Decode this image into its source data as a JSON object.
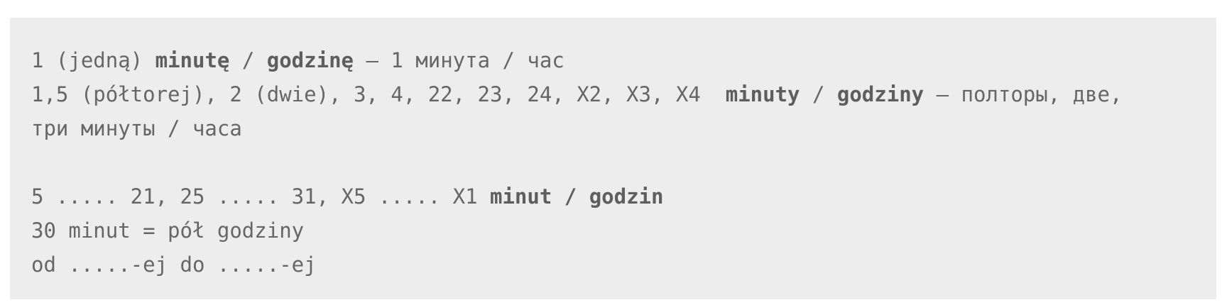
{
  "document": {
    "line1": {
      "a": "1 (jedną) ",
      "b1": "minutę",
      "c": " / ",
      "b2": "godzinę",
      "d": " – 1 минута / час"
    },
    "line2": {
      "a": "1,5 (półtorej), 2 (dwie), 3, 4, 22, 23, 24, X2, X3, X4  ",
      "b1": "minuty",
      "c": " / ",
      "b2": "godziny",
      "d": " – полторы, две,"
    },
    "line3": {
      "a": "три минуты / часа"
    },
    "line4": {
      "a": "5 ..... 21, 25 ..... 31, X5 ..... X1 ",
      "b1": "minut / godzin"
    },
    "line5": {
      "a": "30 minut = pół godziny"
    },
    "line6": {
      "a": "od .....-ej do .....-ej"
    }
  }
}
